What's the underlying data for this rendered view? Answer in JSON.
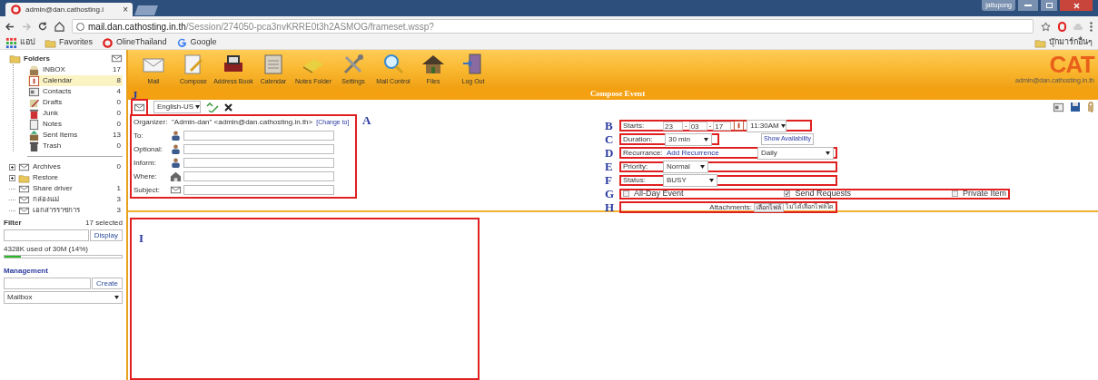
{
  "browser": {
    "tab_title": "admin@dan.cathosting.i",
    "tab_close": "×",
    "url_host": "mail.dan.cathosting.in.th",
    "url_path": "/Session/274050-pca3nvKRRE0t3h2ASMOG/frameset.wssp?",
    "bookmarks": [
      {
        "label": "แอป",
        "kind": "apps"
      },
      {
        "label": "Favorites",
        "kind": "folder"
      },
      {
        "label": "OlineThailand",
        "kind": "ring"
      },
      {
        "label": "Google",
        "kind": "g"
      }
    ],
    "other_bookmarks": "บุ๊กมาร์กอื่นๆ",
    "user_badge": "jattupong"
  },
  "sidebar": {
    "title": "Folders",
    "folders": [
      {
        "name": "INBOX",
        "count": "17",
        "selected": false,
        "kind": "inbox"
      },
      {
        "name": "Calendar",
        "count": "8",
        "selected": true,
        "kind": "calendar"
      },
      {
        "name": "Contacts",
        "count": "4",
        "selected": false,
        "kind": "contacts"
      },
      {
        "name": "Drafts",
        "count": "0",
        "selected": false,
        "kind": "drafts"
      },
      {
        "name": "Junk",
        "count": "0",
        "selected": false,
        "kind": "junk"
      },
      {
        "name": "Notes",
        "count": "0",
        "selected": false,
        "kind": "notes"
      },
      {
        "name": "Sent Items",
        "count": "13",
        "selected": false,
        "kind": "sent"
      },
      {
        "name": "Trash",
        "count": "0",
        "selected": false,
        "kind": "trash"
      }
    ],
    "extra_folders": [
      {
        "name": "Archives",
        "count": "0",
        "expandable": true,
        "kind": "mail"
      },
      {
        "name": "Restore",
        "expandable": true,
        "kind": "folder"
      },
      {
        "name": "Share driver",
        "count": "1",
        "expandable": false,
        "kind": "mail"
      },
      {
        "name": "กล่องแม่",
        "count": "3",
        "expandable": false,
        "kind": "mail"
      },
      {
        "name": "เอกสารราชการ",
        "count": "3",
        "expandable": false,
        "kind": "mail"
      }
    ],
    "filter": {
      "title": "Filter",
      "selected": "17 selected",
      "button": "Display",
      "quota": "4328K used of 30M  (14%)",
      "level": 0.14
    },
    "management": {
      "title": "Management",
      "button": "Create",
      "select": "Mailbox"
    }
  },
  "toolbar": [
    {
      "label": "Mail",
      "kind": "mail"
    },
    {
      "label": "Compose",
      "kind": "compose"
    },
    {
      "label": "Address Book",
      "kind": "book"
    },
    {
      "label": "Calendar",
      "kind": "calendar"
    },
    {
      "label": "Notes Folder",
      "kind": "notes"
    },
    {
      "label": "Settings",
      "kind": "tools"
    },
    {
      "label": "Mail Control",
      "kind": "search"
    },
    {
      "label": "Files",
      "kind": "house"
    },
    {
      "label": "Log Out",
      "kind": "door"
    }
  ],
  "header": {
    "logo": "CAT",
    "user": "admin@dan.cathosting.in.th",
    "title": "Compose Event",
    "mark": "J"
  },
  "compose_toolbar": {
    "language": "English-US"
  },
  "recipients": {
    "mark": "A",
    "organizer_label": "Organizer:",
    "organizer": "\"Admin-dan\" <admin@dan.cathosting.in.th>",
    "change_link": "[Change to]",
    "fields": [
      {
        "label": "To:",
        "kind": "person"
      },
      {
        "label": "Optional:",
        "kind": "person"
      },
      {
        "label": "Inform:",
        "kind": "person"
      },
      {
        "label": "Where:",
        "kind": "house"
      },
      {
        "label": "Subject:",
        "kind": "mail"
      }
    ]
  },
  "event": {
    "starts": {
      "mark": "B",
      "label": "Starts:",
      "day": "23",
      "month": "03",
      "year": "17",
      "separator": "-",
      "time": "11:30AM"
    },
    "duration": {
      "mark": "C",
      "label": "Duration:",
      "value": "30 min",
      "button": "Show Availability"
    },
    "recurrance": {
      "mark": "D",
      "label": "Recurrance:",
      "link": "Add Recurrence",
      "value": "Daily"
    },
    "priority": {
      "mark": "E",
      "label": "Priority:",
      "value": "Normal"
    },
    "status": {
      "mark": "F",
      "label": "Status:",
      "value": "BUSY"
    },
    "options": {
      "mark": "G",
      "items": [
        {
          "label": "All-Day Event",
          "checked": false
        },
        {
          "label": "Send Requests",
          "checked": true
        },
        {
          "label": "Private Item",
          "checked": false
        }
      ]
    },
    "attachments": {
      "mark": "H",
      "label": "Attachments:",
      "button": "เลือกไฟล์",
      "status": "ไม่ได้เลือกไฟล์ใด"
    }
  },
  "body": {
    "mark": "I"
  }
}
